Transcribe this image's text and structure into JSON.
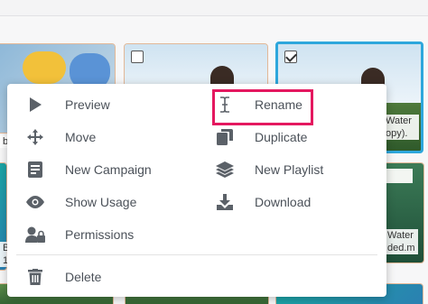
{
  "gallery": {
    "captions": {
      "tile_right_top": [
        "Water",
        "opy)."
      ],
      "tile_left_mid": "b",
      "tile_left_bottom": [
        "B",
        "1"
      ],
      "tile_right_bottom": [
        "Water",
        "ded.m"
      ]
    }
  },
  "context_menu": {
    "left_items": [
      {
        "label": "Preview",
        "icon": "play-icon"
      },
      {
        "label": "Move",
        "icon": "move-arrows-icon"
      },
      {
        "label": "New Campaign",
        "icon": "campaign-document-icon"
      },
      {
        "label": "Show Usage",
        "icon": "eye-icon"
      },
      {
        "label": "Permissions",
        "icon": "user-lock-icon"
      }
    ],
    "right_items": [
      {
        "label": "Rename",
        "icon": "text-cursor-icon"
      },
      {
        "label": "Duplicate",
        "icon": "duplicate-icon"
      },
      {
        "label": "New Playlist",
        "icon": "layers-icon"
      },
      {
        "label": "Download",
        "icon": "download-icon"
      }
    ],
    "bottom_items": [
      {
        "label": "Delete",
        "icon": "trash-icon"
      }
    ],
    "highlight_color": "#e4185f",
    "icon_color": "#5b6168"
  },
  "selection_color": "#2ea7dc"
}
